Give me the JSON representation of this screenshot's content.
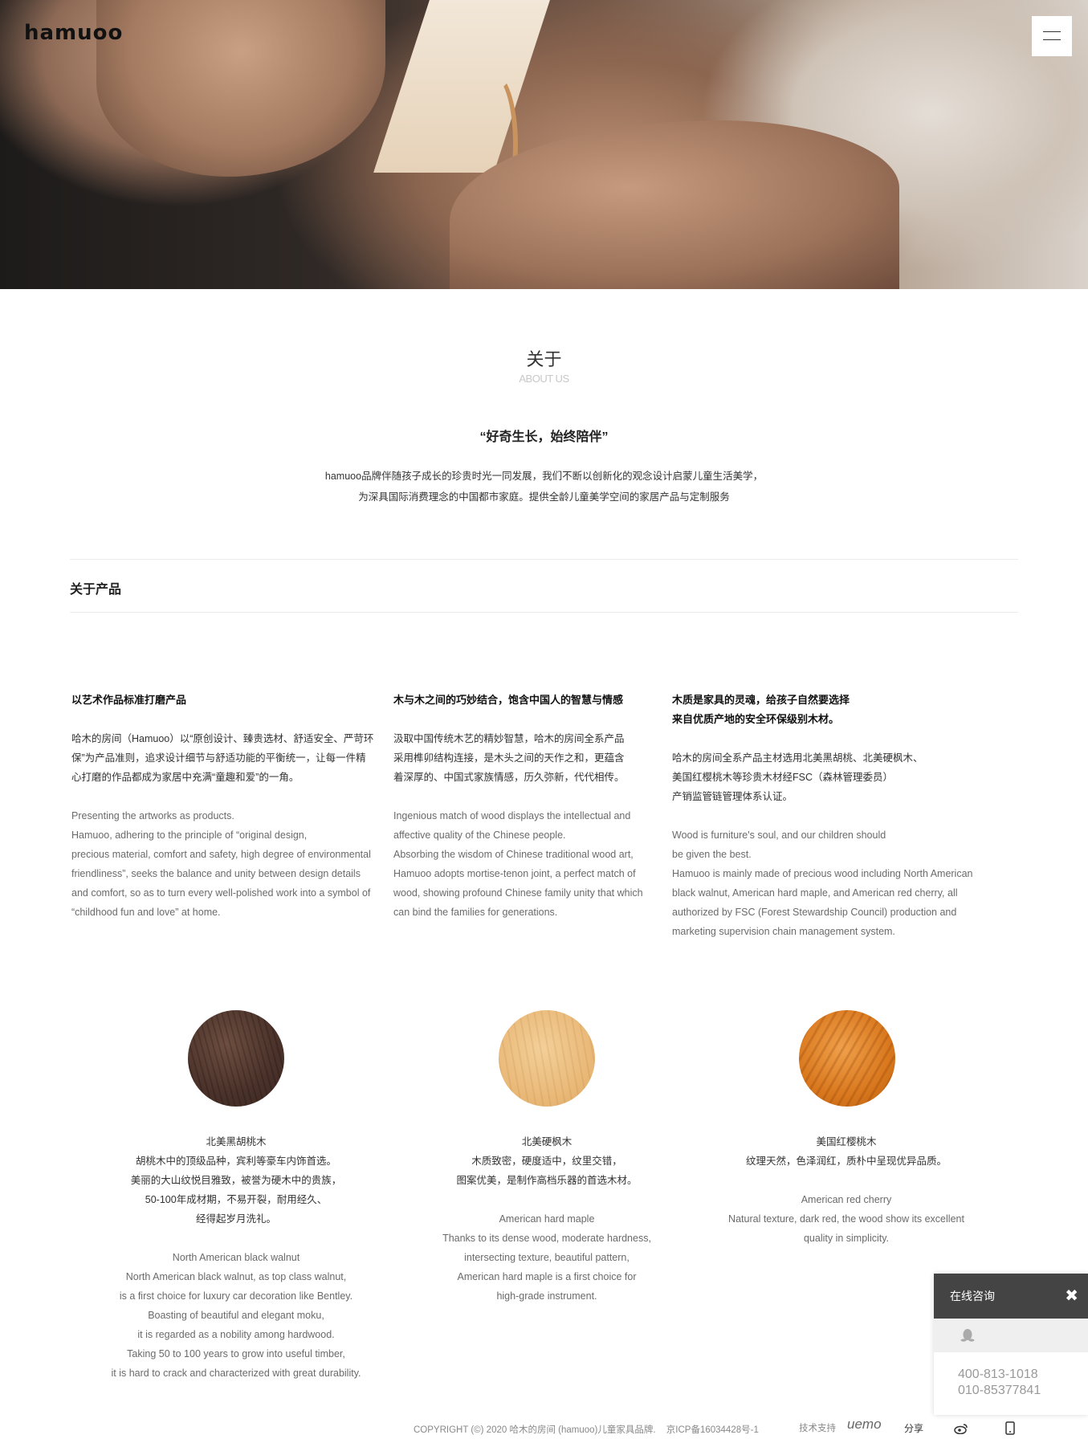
{
  "header": {
    "logo": "hamuoo",
    "menu_icon": "hamburger-icon"
  },
  "about": {
    "title": "关于",
    "subtitle": "ABOUT US",
    "slogan": "“好奇生长，始终陪伴”",
    "intro_line1": "hamuoo品牌伴随孩子成长的珍贵时光一同发展，我们不断以创新化的观念设计启蒙儿童生活美学，",
    "intro_line2": "为深具国际消费理念的中国都市家庭。提供全龄儿童美学空间的家居产品与定制服务"
  },
  "products": {
    "heading": "关于产品",
    "columns": [
      {
        "title_lines": [
          "以艺术作品标准打磨产品"
        ],
        "cn_lines": [
          "哈木的房间（Hamuoo）以“原创设计、臻贵选材、舒适安全、严苛环",
          "保”为产品准则，追求设计细节与舒适功能的平衡统一，让每一件精",
          "心打磨的作品都成为家居中充满“童趣和爱”的一角。"
        ],
        "en_lines": [
          "Presenting the artworks as products.",
          "Hamuoo, adhering to the principle of “original design,",
          "precious material, comfort and safety, high degree of environmental",
          "friendliness”, seeks the balance and unity between design details",
          "and comfort, so as to turn every well-polished work into a symbol of",
          "“childhood fun and love” at home."
        ]
      },
      {
        "title_lines": [
          "木与木之间的巧妙结合，饱含中国人的智慧与情感"
        ],
        "cn_lines": [
          "汲取中国传统木艺的精妙智慧，哈木的房间全系产品",
          "采用榫卯结构连接，是木头之间的天作之和，更蕴含",
          "着深厚的、中国式家族情感，历久弥新，代代相传。"
        ],
        "en_lines": [
          "Ingenious match of wood displays the intellectual and",
          "affective quality of the Chinese people.",
          "Absorbing the wisdom of Chinese traditional wood art,",
          "Hamuoo adopts mortise-tenon joint, a perfect match of",
          "wood, showing profound Chinese family unity that which",
          "can bind the families for generations."
        ]
      },
      {
        "title_lines": [
          "木质是家具的灵魂，给孩子自然要选择",
          "来自优质产地的安全环保级别木材。"
        ],
        "cn_lines": [
          "哈木的房间全系产品主材选用北美黑胡桃、北美硬枫木、",
          "美国红樱桃木等珍贵木材经FSC（森林管理委员）",
          "产销监管链管理体系认证。"
        ],
        "en_lines": [
          "Wood is furniture's soul, and our children should",
          "be given the best.",
          "Hamuoo is mainly made of precious wood including North American",
          "black walnut, American hard maple, and American red cherry, all",
          "authorized by FSC (Forest Stewardship Council) production and",
          "marketing supervision chain management system."
        ]
      }
    ]
  },
  "woods": [
    {
      "name": "北美黑胡桃木",
      "cn_lines": [
        "胡桃木中的顶级品种，宾利等豪车内饰首选。",
        "美丽的大山纹悦目雅致，被誉为硬木中的贵族，",
        "50-100年成材期，不易开裂，耐用经久、",
        "经得起岁月洗礼。"
      ],
      "en_lines": [
        "North American black walnut",
        "North American black walnut, as top class walnut,",
        "is a first choice for luxury car decoration like Bentley.",
        "Boasting of beautiful and elegant moku,",
        "it is regarded as a nobility among hardwood.",
        "Taking 50 to 100 years to grow into useful timber,",
        "it is hard to crack and characterized with great durability."
      ]
    },
    {
      "name": "北美硬枫木",
      "cn_lines": [
        "木质致密，硬度适中，纹里交错，",
        "图案优美，是制作高档乐器的首选木材。"
      ],
      "en_lines": [
        "American hard maple",
        "Thanks to its dense wood, moderate hardness,",
        "intersecting texture, beautiful pattern,",
        "American hard maple is a first choice for",
        "high-grade instrument."
      ]
    },
    {
      "name": "美国红樱桃木",
      "cn_lines": [
        "纹理天然，色泽润红，质朴中呈现优异品质。"
      ],
      "en_lines": [
        "American red cherry",
        "Natural texture, dark red, the wood show its excellent",
        "quality in simplicity."
      ]
    }
  ],
  "consult": {
    "title": "在线咨询",
    "close": "✖",
    "qq_icon": "qq-penguin-icon",
    "phone1": "400-813-1018",
    "phone2": "010-85377841"
  },
  "footer": {
    "copyright": "COPYRIGHT (©) 2020 哈木的房间 (hamuoo)儿童家具品牌.",
    "icp": "京ICP备16034428号-1",
    "tech": "技术支持",
    "tech_brand": "uemo",
    "share": "分享",
    "weibo_icon": "weibo-icon",
    "mobile_icon": "mobile-icon"
  },
  "colors": {
    "consult_bar": "#444444",
    "muted_text": "#6a6a6a",
    "walnut": "#4a322a",
    "maple": "#e9b877",
    "cherry": "#d9781e"
  }
}
